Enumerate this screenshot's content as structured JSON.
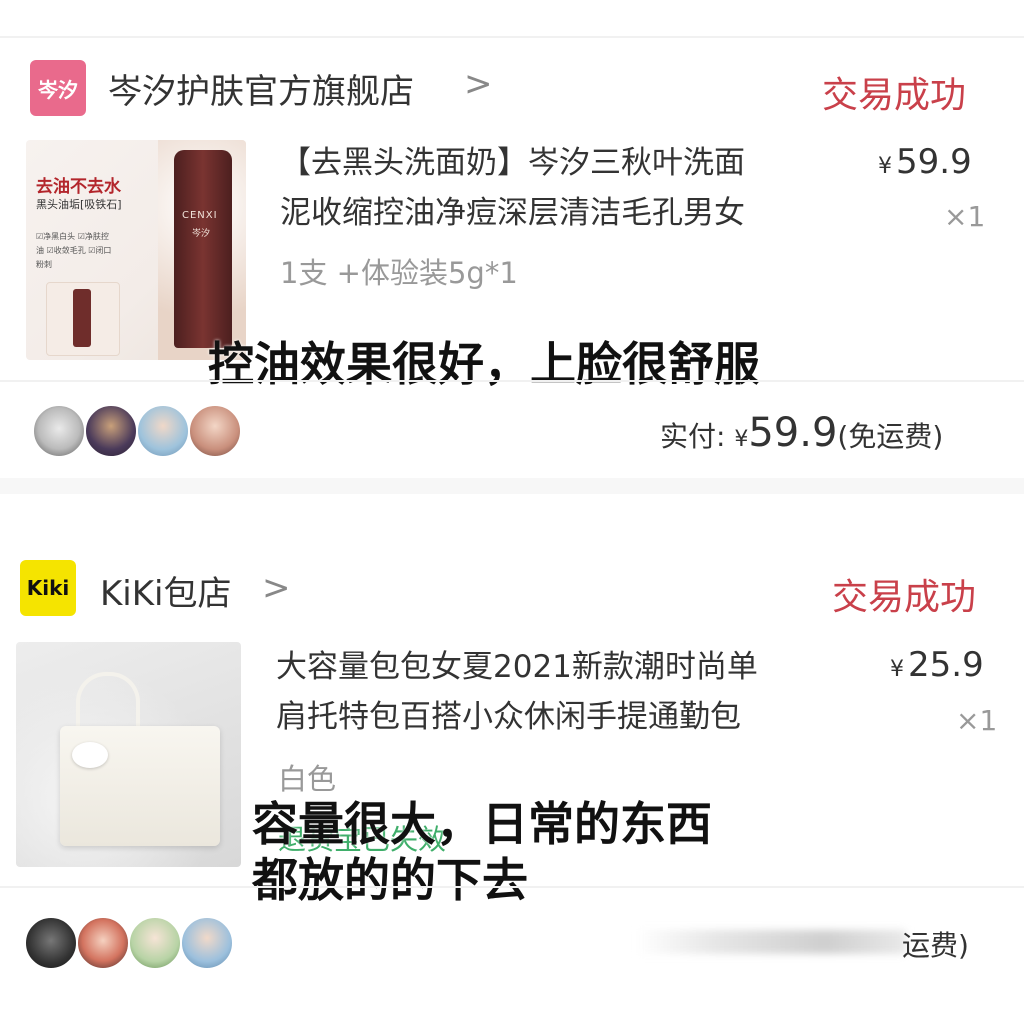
{
  "orders": [
    {
      "shop": {
        "logo_text": "岑汐",
        "name": "岑汐护肤官方旗舰店",
        "chevron": ">"
      },
      "status": "交易成功",
      "product": {
        "title_line1": "【去黑头洗面奶】岑汐三秋叶洗面",
        "title_line2": "泥收缩控油净痘深层清洁毛孔男女",
        "spec": "1支 +体验装5g*1",
        "price_symbol": "¥",
        "price": "59.9",
        "qty": "×1",
        "image_text": {
          "line1": "去油不去水",
          "line2": "黑头油垢[吸铁石]",
          "brand": "CENXI",
          "brand_cn": "岑汐",
          "tags": "☑净黑白头 ☑净肤控油 ☑收敛毛孔 ☑闭口粉刺"
        }
      },
      "review_overlay": "控油效果很好，上脸很舒服",
      "payment": {
        "label": "实付:",
        "symbol": "¥",
        "amount": "59.9",
        "note": "(免运费)"
      }
    },
    {
      "shop": {
        "logo_text": "Kiki",
        "name": "KiKi包店",
        "chevron": ">"
      },
      "status": "交易成功",
      "product": {
        "title_line1": "大容量包包女夏2021新款潮时尚单",
        "title_line2": "肩托特包百搭小众休闲手提通勤包",
        "spec": "白色",
        "spec2_hidden": "退货宝已失效",
        "price_symbol": "¥",
        "price": "25.9",
        "qty": "×1"
      },
      "review_overlay_line1": "容量很大，日常的东西",
      "review_overlay_line2": "都放的的下去",
      "payment": {
        "note_partial": "运费)"
      }
    }
  ],
  "colors": {
    "status": "#c9404a",
    "shop1_logo_bg": "#e96a8c",
    "shop2_logo_bg": "#f5e400"
  }
}
